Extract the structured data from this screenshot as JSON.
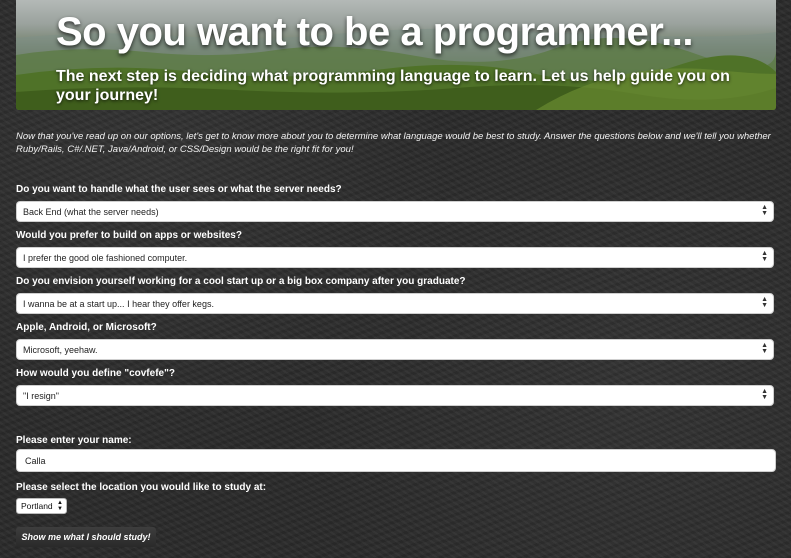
{
  "hero": {
    "title": "So you want to be a programmer...",
    "subtitle": "The next step is deciding what programming language to learn. Let us help guide you on your journey!"
  },
  "intro": "Now that you've read up on our options, let's get to know more about you to determine what language would be best to study. Answer the questions below and we'll tell you whether Ruby/Rails, C#/.NET, Java/Android, or CSS/Design would be the right fit for you!",
  "questions": [
    {
      "label": "Do you want to handle what the user sees or what the server needs?",
      "selected": "Back End (what the server needs)"
    },
    {
      "label": "Would you prefer to build on apps or websites?",
      "selected": "I prefer the good ole fashioned computer."
    },
    {
      "label": "Do you envision yourself working for a cool start up or a big box company after you graduate?",
      "selected": "I wanna be at a start up... I hear they offer kegs."
    },
    {
      "label": "Apple, Android, or Microsoft?",
      "selected": "Microsoft, yeehaw."
    },
    {
      "label": "How would you define \"covfefe\"?",
      "selected": "\"I resign\""
    }
  ],
  "name_field": {
    "label": "Please enter your name:",
    "value": "Calla"
  },
  "location": {
    "label": "Please select the location you would like to study at:",
    "selected": "Portland"
  },
  "submit_label": "Show me what I should study!",
  "icons": {
    "select_arrows": "up-down-chevron-icon"
  }
}
